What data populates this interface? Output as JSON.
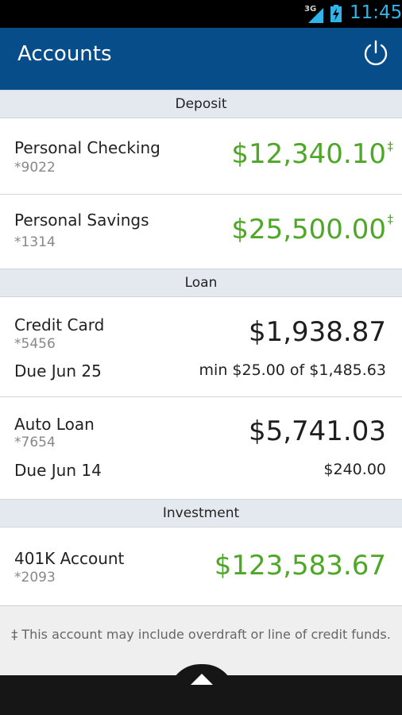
{
  "status_bar": {
    "network": "3G",
    "time": "11:45"
  },
  "header": {
    "title": "Accounts"
  },
  "sections": {
    "deposit": {
      "title": "Deposit",
      "accounts": [
        {
          "name": "Personal Checking",
          "number": "*9022",
          "balance": "$12,340.10",
          "marker": "‡"
        },
        {
          "name": "Personal Savings",
          "number": "*1314",
          "balance": "$25,500.00",
          "marker": "‡"
        }
      ]
    },
    "loan": {
      "title": "Loan",
      "accounts": [
        {
          "name": "Credit Card",
          "number": "*5456",
          "balance": "$1,938.87",
          "due": "Due Jun 25",
          "payment": "min $25.00 of $1,485.63"
        },
        {
          "name": "Auto Loan",
          "number": "*7654",
          "balance": "$5,741.03",
          "due": "Due Jun 14",
          "payment": "$240.00"
        }
      ]
    },
    "investment": {
      "title": "Investment",
      "accounts": [
        {
          "name": "401K Account",
          "number": "*2093",
          "balance": "$123,583.67"
        }
      ]
    }
  },
  "footnote": "‡ This account may include overdraft or line of credit funds.",
  "colors": {
    "header": "#064d8a",
    "positive": "#4ea726",
    "clock": "#2fb5ea"
  },
  "icons": {
    "power": "power-icon",
    "up": "chevron-up-icon"
  }
}
